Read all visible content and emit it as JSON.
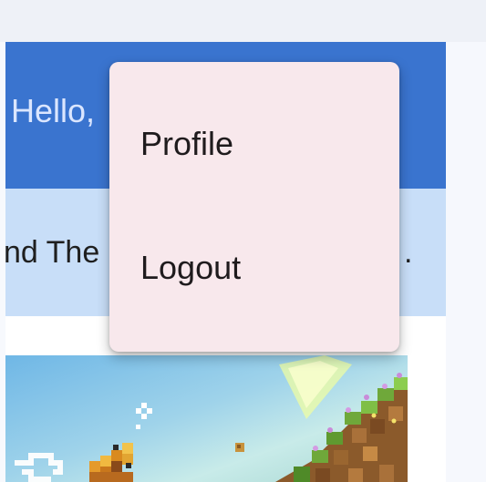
{
  "header": {
    "greeting": "Hello,"
  },
  "banner": {
    "text": "nd The",
    "tail": "."
  },
  "menu": {
    "items": [
      {
        "label": "Profile"
      },
      {
        "label": "Logout"
      }
    ]
  },
  "colors": {
    "header": "#3a74cf",
    "banner": "#c8def8",
    "menu_background": "#f8e8ec"
  }
}
